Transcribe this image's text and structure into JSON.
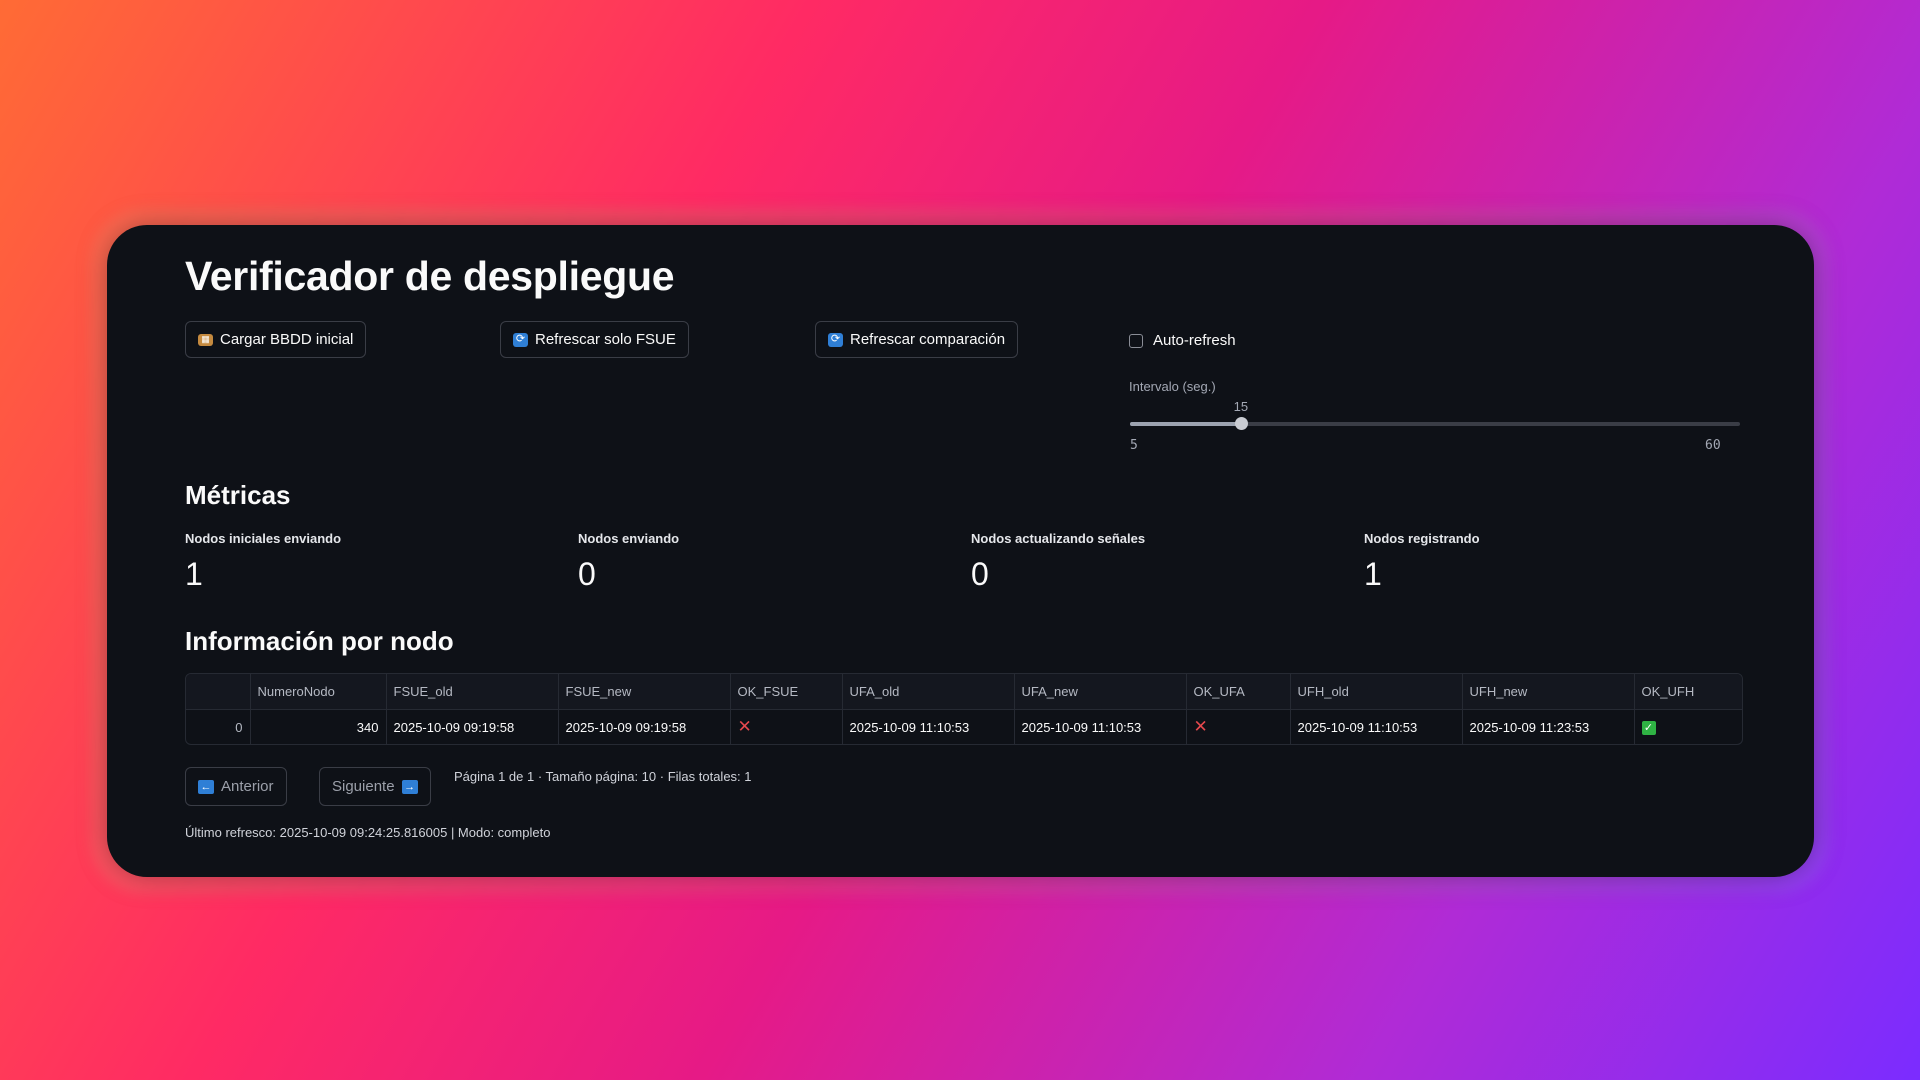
{
  "header": {
    "title": "Verificador de despliegue"
  },
  "toolbar": {
    "load_label": "Cargar BBDD inicial",
    "refresh_fsue_label": "Refrescar solo FSUE",
    "refresh_compare_label": "Refrescar comparación",
    "autorefresh_label": "Auto-refresh",
    "autorefresh_checked": false
  },
  "interval": {
    "label": "Intervalo (seg.)",
    "value": "15",
    "min": "5",
    "max": "60"
  },
  "metrics": {
    "title": "Métricas",
    "items": [
      {
        "label": "Nodos iniciales enviando",
        "value": "1"
      },
      {
        "label": "Nodos enviando",
        "value": "0"
      },
      {
        "label": "Nodos actualizando señales",
        "value": "0"
      },
      {
        "label": "Nodos registrando",
        "value": "1"
      }
    ]
  },
  "nodes": {
    "title": "Información por nodo",
    "columns": [
      "",
      "NumeroNodo",
      "FSUE_old",
      "FSUE_new",
      "OK_FSUE",
      "UFA_old",
      "UFA_new",
      "OK_UFA",
      "UFH_old",
      "UFH_new",
      "OK_UFH"
    ],
    "rows": [
      {
        "index": "0",
        "numero_nodo": "340",
        "fsue_old": "2025-10-09 09:19:58",
        "fsue_new": "2025-10-09 09:19:58",
        "ok_fsue": "✕",
        "ufa_old": "2025-10-09 11:10:53",
        "ufa_new": "2025-10-09 11:10:53",
        "ok_ufa": "✕",
        "ufh_old": "2025-10-09 11:10:53",
        "ufh_new": "2025-10-09 11:23:53",
        "ok_ufh": "✓"
      }
    ]
  },
  "pager": {
    "prev_label": "Anterior",
    "next_label": "Siguiente",
    "info": "Página 1 de 1 · Tamaño página: 10 · Filas totales: 1"
  },
  "footer": {
    "text": "Último refresco: 2025-10-09 09:24:25.816005 | Modo: completo"
  },
  "colors": {
    "card_bg": "#0e1117",
    "accent_blue": "#2f7fd6",
    "error_red": "#e5484d",
    "ok_green": "#2fb344"
  }
}
